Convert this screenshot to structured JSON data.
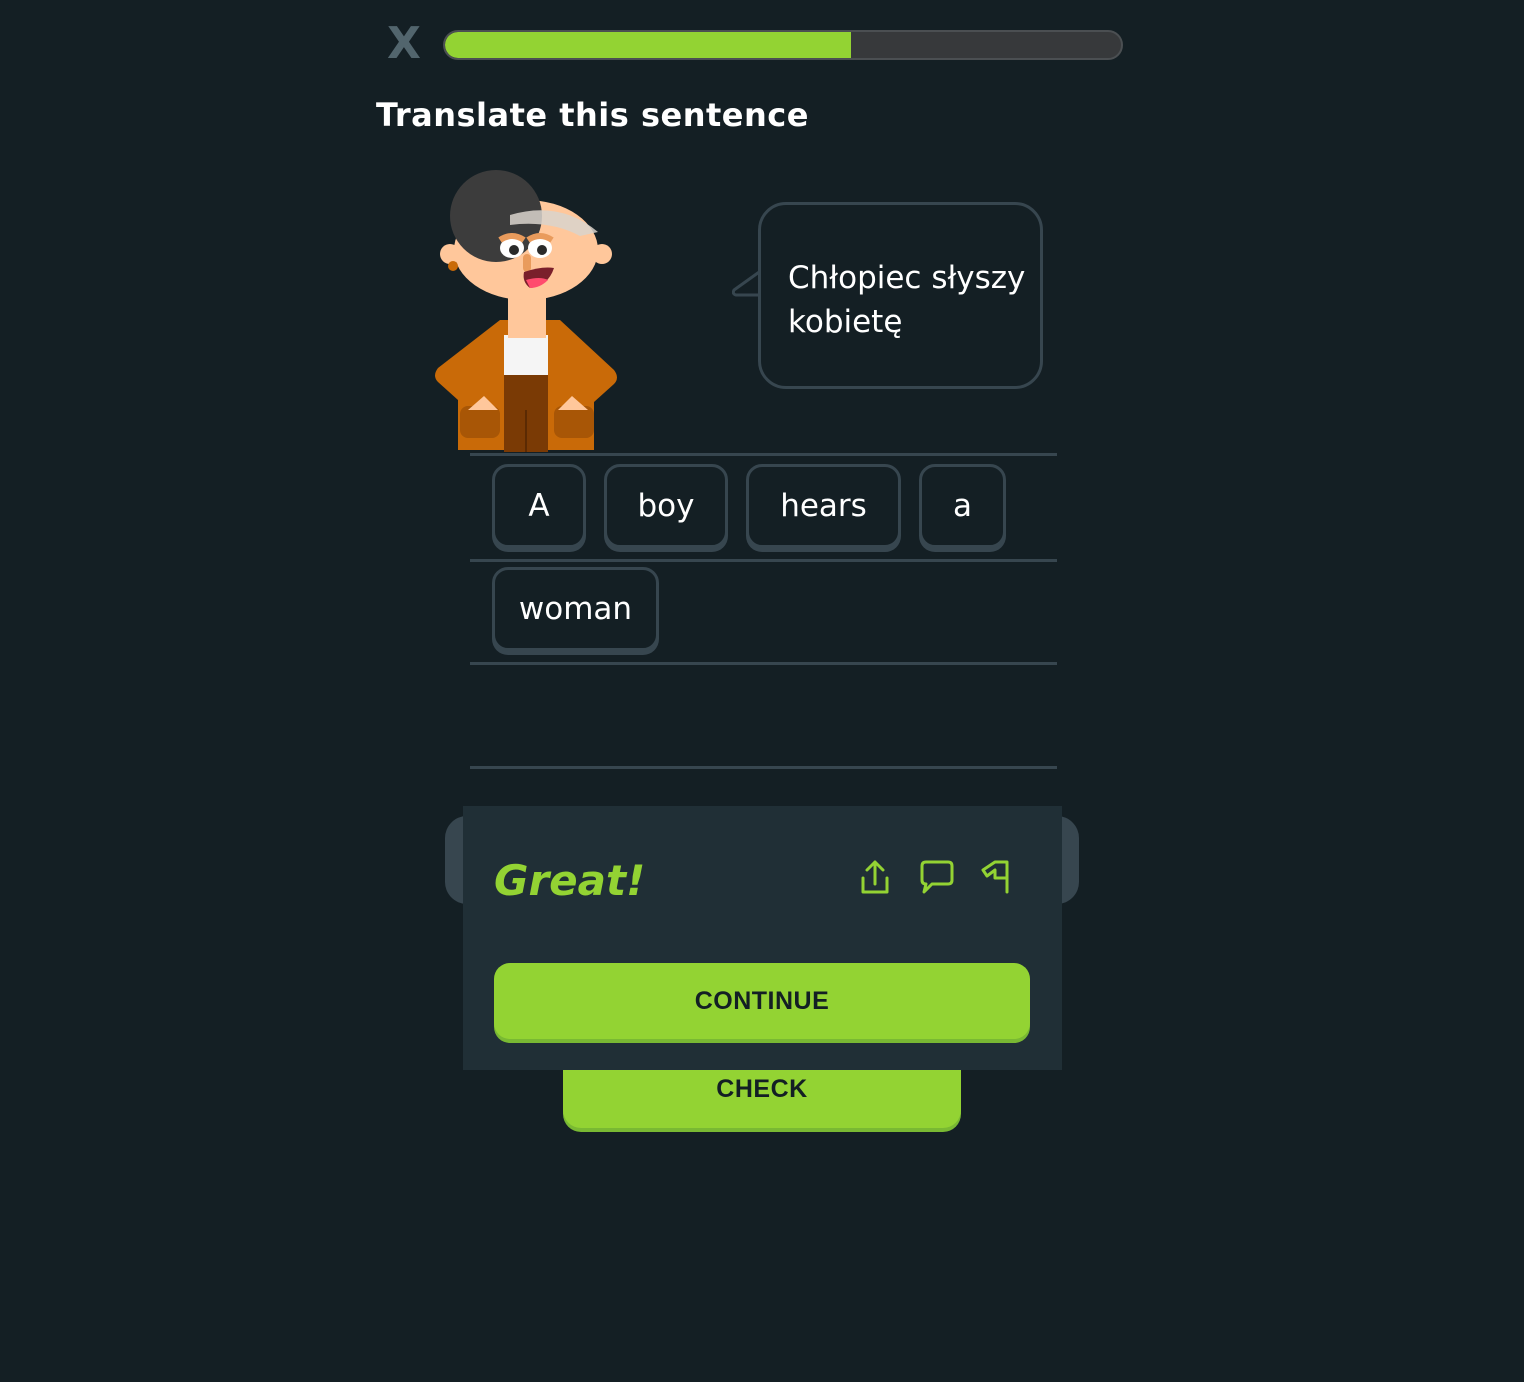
{
  "header": {
    "close_label": "X",
    "progress_fraction": 0.6
  },
  "prompt": {
    "title": "Translate this sentence",
    "sentence_line1": "Chłopiec słyszy",
    "sentence_line2": "kobietę"
  },
  "answer": {
    "words": [
      "A",
      "boy",
      "hears",
      "a",
      "woman"
    ]
  },
  "feedback": {
    "message": "Great!",
    "continue_label": "CONTINUE",
    "icons": [
      "share-icon",
      "comment-icon",
      "report-flag-icon"
    ]
  },
  "footer": {
    "check_label": "CHECK"
  },
  "colors": {
    "background": "#141f24",
    "accent_green": "#93d333",
    "panel": "#202f36",
    "border": "#37464f"
  }
}
